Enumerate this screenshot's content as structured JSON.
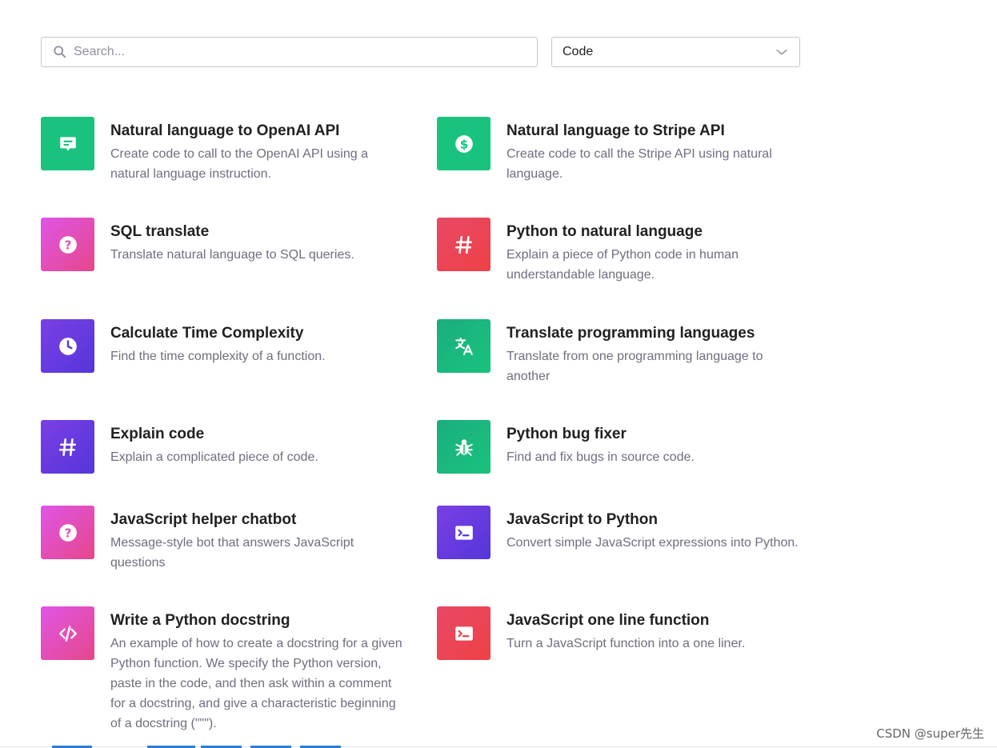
{
  "search": {
    "placeholder": "Search..."
  },
  "filter": {
    "selected": "Code"
  },
  "examples": [
    {
      "title": "Natural language to OpenAI API",
      "desc": "Create code to call to the OpenAI API using a natural language instruction.",
      "icon": "message-icon",
      "color": "#19c37d"
    },
    {
      "title": "Natural language to Stripe API",
      "desc": "Create code to call the Stripe API using natural language.",
      "icon": "dollar-icon",
      "color": "#19c37d"
    },
    {
      "title": "SQL translate",
      "desc": "Translate natural language to SQL queries.",
      "icon": "question-icon",
      "color": "#dd5ce5"
    },
    {
      "title": "Python to natural language",
      "desc": "Explain a piece of Python code in human understandable language.",
      "icon": "hashtag-icon",
      "color": "#ef4146"
    },
    {
      "title": "Calculate Time Complexity",
      "desc": "Find the time complexity of a function.",
      "icon": "clock-icon",
      "color": "#5436da"
    },
    {
      "title": "Translate programming languages",
      "desc": "Translate from one programming language to another",
      "icon": "translate-icon",
      "color": "#19c37d"
    },
    {
      "title": "Explain code",
      "desc": "Explain a complicated piece of code.",
      "icon": "hashtag-icon",
      "color": "#5436da"
    },
    {
      "title": "Python bug fixer",
      "desc": "Find and fix bugs in source code.",
      "icon": "bug-icon",
      "color": "#19c37d"
    },
    {
      "title": "JavaScript helper chatbot",
      "desc": "Message-style bot that answers JavaScript questions",
      "icon": "question-icon",
      "color": "#dd5ce5"
    },
    {
      "title": "JavaScript to Python",
      "desc": "Convert simple JavaScript expressions into Python.",
      "icon": "terminal-icon",
      "color": "#5436da"
    },
    {
      "title": "Write a Python docstring",
      "desc": "An example of how to create a docstring for a given Python function. We specify the Python version, paste in the code, and then ask within a comment for a docstring, and give a characteristic beginning of a docstring (\"\"\").",
      "icon": "code-icon",
      "color": "#dd5ce5"
    },
    {
      "title": "JavaScript one line function",
      "desc": "Turn a JavaScript function into a one liner.",
      "icon": "terminal-icon",
      "color": "#ef4146"
    }
  ],
  "watermark": "CSDN @super先生"
}
